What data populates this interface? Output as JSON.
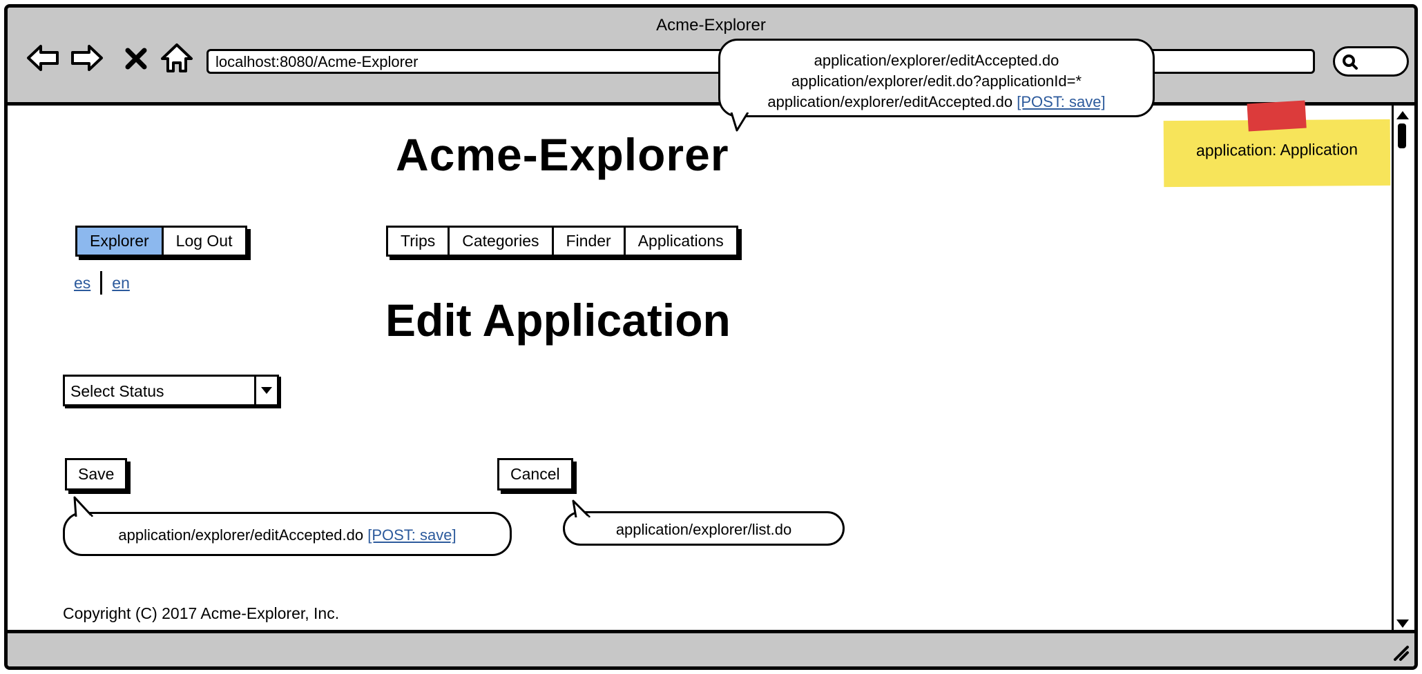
{
  "window": {
    "title": "Acme-Explorer",
    "url": "localhost:8080/Acme-Explorer"
  },
  "header": {
    "title": "Acme-Explorer"
  },
  "account_menu": {
    "items": [
      {
        "label": "Explorer",
        "active": true
      },
      {
        "label": "Log Out",
        "active": false
      }
    ]
  },
  "main_menu": {
    "items": [
      {
        "label": "Trips"
      },
      {
        "label": "Categories"
      },
      {
        "label": "Finder"
      },
      {
        "label": "Applications"
      }
    ]
  },
  "language": {
    "es": "es",
    "en": "en"
  },
  "page": {
    "title": "Edit Application",
    "status_select": {
      "value": "Select Status"
    },
    "save_label": "Save",
    "cancel_label": "Cancel"
  },
  "annotations": {
    "top": {
      "line1": "application/explorer/editAccepted.do",
      "line2": "application/explorer/edit.do?applicationId=*",
      "line3": "application/explorer/editAccepted.do",
      "line3_link": "[POST: save]"
    },
    "save": {
      "text": "application/explorer/editAccepted.do",
      "link": "[POST: save]"
    },
    "cancel": {
      "text": "application/explorer/list.do"
    },
    "sticky_note": "application: Application"
  },
  "footer": {
    "copyright": "Copyright (C) 2017 Acme-Explorer, Inc."
  },
  "colors": {
    "chrome": "#c7c7c7",
    "active_tab": "#8cb8ee",
    "link": "#2c5a9c",
    "sticky": "#f7e45a",
    "tape": "#dc3b3b"
  }
}
